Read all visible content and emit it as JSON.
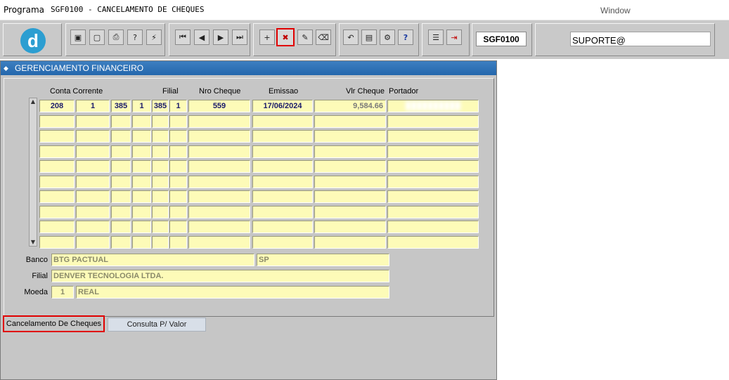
{
  "menubar": {
    "program_label": "Programa",
    "title": "SGF0100 - CANCELAMENTO DE CHEQUES",
    "window_label": "Window"
  },
  "toolbar": {
    "logo_letter": "d",
    "program_code": "SGF0100",
    "user": "SUPORTE@",
    "buttons": [
      {
        "icon": "save-icon",
        "glyph": "▣"
      },
      {
        "icon": "screen-icon",
        "glyph": "▢"
      },
      {
        "icon": "print-icon",
        "glyph": "⎙"
      },
      {
        "icon": "query-icon",
        "glyph": "?"
      },
      {
        "icon": "execute-query-icon",
        "glyph": "⚡"
      },
      {
        "icon": "first-record-icon",
        "glyph": "⏮"
      },
      {
        "icon": "previous-record-icon",
        "glyph": "◀"
      },
      {
        "icon": "next-record-icon",
        "glyph": "▶"
      },
      {
        "icon": "last-record-icon",
        "glyph": "⏭"
      },
      {
        "icon": "insert-record-icon",
        "glyph": "+"
      },
      {
        "icon": "delete-record-icon",
        "glyph": "✖"
      },
      {
        "icon": "edit-record-icon",
        "glyph": "✎"
      },
      {
        "icon": "clear-record-icon",
        "glyph": "⌫"
      },
      {
        "icon": "undo-icon",
        "glyph": "↶"
      },
      {
        "icon": "list-icon",
        "glyph": "▤"
      },
      {
        "icon": "settings-icon",
        "glyph": "⚙"
      },
      {
        "icon": "help-icon",
        "glyph": "?"
      },
      {
        "icon": "menu-icon",
        "glyph": "☰"
      },
      {
        "icon": "exit-icon",
        "glyph": "⇥"
      }
    ]
  },
  "window": {
    "title": "GERENCIAMENTO FINANCEIRO"
  },
  "grid": {
    "headers": {
      "conta_corrente": "Conta Corrente",
      "filial": "Filial",
      "nro_cheque": "Nro Cheque",
      "emissao": "Emissao",
      "vlr_cheque": "Vlr Cheque",
      "portador": "Portador"
    },
    "rows": [
      [
        "208",
        "1",
        "385",
        "1",
        "385",
        "1",
        "559",
        "17/06/2024",
        "9,584.66",
        "██████████"
      ],
      [
        "",
        "",
        "",
        "",
        "",
        "",
        "",
        "",
        "",
        ""
      ],
      [
        "",
        "",
        "",
        "",
        "",
        "",
        "",
        "",
        "",
        ""
      ],
      [
        "",
        "",
        "",
        "",
        "",
        "",
        "",
        "",
        "",
        ""
      ],
      [
        "",
        "",
        "",
        "",
        "",
        "",
        "",
        "",
        "",
        ""
      ],
      [
        "",
        "",
        "",
        "",
        "",
        "",
        "",
        "",
        "",
        ""
      ],
      [
        "",
        "",
        "",
        "",
        "",
        "",
        "",
        "",
        "",
        ""
      ],
      [
        "",
        "",
        "",
        "",
        "",
        "",
        "",
        "",
        "",
        ""
      ],
      [
        "",
        "",
        "",
        "",
        "",
        "",
        "",
        "",
        "",
        ""
      ],
      [
        "",
        "",
        "",
        "",
        "",
        "",
        "",
        "",
        "",
        ""
      ]
    ]
  },
  "details": {
    "banco_label": "Banco",
    "banco_name": "BTG PACTUAL",
    "banco_uf": "SP",
    "filial_label": "Filial",
    "filial_name": "DENVER TECNOLOGIA LTDA.",
    "moeda_label": "Moeda",
    "moeda_code": "1",
    "moeda_name": "REAL"
  },
  "tabs": [
    {
      "label": "Cancelamento De Cheques",
      "active": true
    },
    {
      "label": "Consulta P/ Valor",
      "active": false
    }
  ]
}
